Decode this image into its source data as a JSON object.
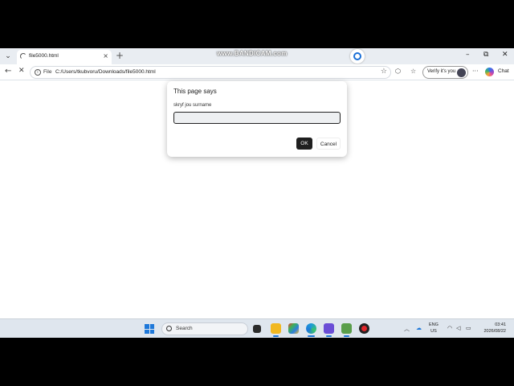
{
  "browser": {
    "tab_title": "file5000.html",
    "tab_close": "×",
    "new_tab": "+",
    "watermark": "www.BANDICAM.com",
    "window_minimize": "–",
    "window_restore": "⧉",
    "window_close": "✕",
    "back": "←",
    "reload": "✕",
    "file_label": "File",
    "url": "C:/Users/tkubvoru/Downloads/file5000.html",
    "verify_label": "Verify it's you",
    "menu": "···",
    "chat_label": "Chat"
  },
  "dialog": {
    "title": "This page says",
    "message": "skryf jou surname",
    "input_value": "",
    "ok_label": "OK",
    "cancel_label": "Cancel"
  },
  "taskbar": {
    "search_placeholder": "Search",
    "lang_line1": "ENG",
    "lang_line2": "US",
    "time": "03:41",
    "date": "2026/08/22"
  },
  "colors": {
    "accent": "#1e78d9",
    "ok_button": "#1f1f1f"
  }
}
